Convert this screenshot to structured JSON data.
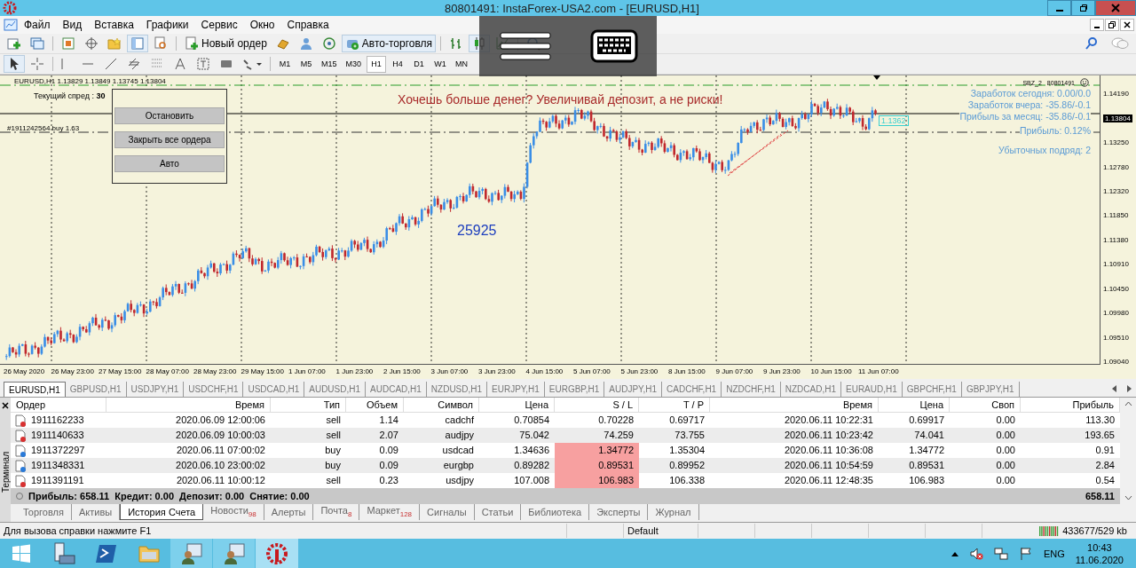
{
  "window": {
    "title": "80801491: InstaForex-USA2.com - [EURUSD,H1]"
  },
  "menu": [
    "Файл",
    "Вид",
    "Вставка",
    "Графики",
    "Сервис",
    "Окно",
    "Справка"
  ],
  "toolbar": {
    "new_order": "Новый ордер",
    "autotrading": "Авто-торговля"
  },
  "timeframes": [
    {
      "label": "M1",
      "selected": false
    },
    {
      "label": "M5",
      "selected": false
    },
    {
      "label": "M15",
      "selected": false
    },
    {
      "label": "M30",
      "selected": false
    },
    {
      "label": "H1",
      "selected": true
    },
    {
      "label": "H4",
      "selected": false
    },
    {
      "label": "D1",
      "selected": false
    },
    {
      "label": "W1",
      "selected": false
    },
    {
      "label": "MN",
      "selected": false
    }
  ],
  "chart": {
    "header": "EURUSD,H1  1.13829 1.13849 1.13745 1.13804",
    "spread_label": "Текущий спред :",
    "spread_value": "30",
    "panel_buttons": [
      "Остановить",
      "Закрыть все ордера",
      "Авто"
    ],
    "order_line_label": "#1911242564 buy 1.63",
    "banner": "Хочешь больше денег? Увеличивай депозит, а не риски!",
    "counter": "25925",
    "expert": "SBZ_2",
    "account": "80801491",
    "stats": [
      "Заработок сегодня: 0.00/0.0",
      "Заработок вчера: -35.86/-0.1",
      "Прибыль за месяц: -35.86/-0.1",
      "Прибыль: 0.12%",
      "Убыточных подряд: 2"
    ],
    "line_price": "1.1362",
    "price_axis": [
      {
        "label": "1.14190",
        "kind": "tick"
      },
      {
        "label": "1.13804",
        "kind": "current"
      },
      {
        "label": "1.13250",
        "kind": "tick"
      },
      {
        "label": "1.12780",
        "kind": "tick"
      },
      {
        "label": "1.12320",
        "kind": "tick"
      },
      {
        "label": "1.11850",
        "kind": "tick"
      },
      {
        "label": "1.11380",
        "kind": "tick"
      },
      {
        "label": "1.10910",
        "kind": "tick"
      },
      {
        "label": "1.10450",
        "kind": "tick"
      },
      {
        "label": "1.09980",
        "kind": "tick"
      },
      {
        "label": "1.09510",
        "kind": "tick"
      },
      {
        "label": "1.09040",
        "kind": "tick"
      }
    ],
    "time_axis": [
      "26 May 2020",
      "26 May 23:00",
      "27 May 15:00",
      "28 May 07:00",
      "28 May 23:00",
      "29 May 15:00",
      "1 Jun 07:00",
      "1 Jun 23:00",
      "2 Jun 15:00",
      "3 Jun 07:00",
      "3 Jun 23:00",
      "4 Jun 15:00",
      "5 Jun 07:00",
      "5 Jun 23:00",
      "8 Jun 15:00",
      "9 Jun 07:00",
      "9 Jun 23:00",
      "10 Jun 15:00",
      "11 Jun 07:00"
    ]
  },
  "symbol_tabs": [
    {
      "label": "EURUSD,H1",
      "selected": true
    },
    {
      "label": "GBPUSD,H1",
      "selected": false
    },
    {
      "label": "USDJPY,H1",
      "selected": false
    },
    {
      "label": "USDCHF,H1",
      "selected": false
    },
    {
      "label": "USDCAD,H1",
      "selected": false
    },
    {
      "label": "AUDUSD,H1",
      "selected": false
    },
    {
      "label": "AUDCAD,H1",
      "selected": false
    },
    {
      "label": "NZDUSD,H1",
      "selected": false
    },
    {
      "label": "EURJPY,H1",
      "selected": false
    },
    {
      "label": "EURGBP,H1",
      "selected": false
    },
    {
      "label": "AUDJPY,H1",
      "selected": false
    },
    {
      "label": "CADCHF,H1",
      "selected": false
    },
    {
      "label": "NZDCHF,H1",
      "selected": false
    },
    {
      "label": "NZDCAD,H1",
      "selected": false
    },
    {
      "label": "EURAUD,H1",
      "selected": false
    },
    {
      "label": "GBPCHF,H1",
      "selected": false
    },
    {
      "label": "GBPJPY,H1",
      "selected": false
    }
  ],
  "terminal": {
    "side_label": "Терминал",
    "columns": [
      "Ордер",
      "Время",
      "Тип",
      "Объем",
      "Символ",
      "Цена",
      "S / L",
      "T / P",
      "Время",
      "Цена",
      "Своп",
      "Прибыль"
    ],
    "rows": [
      {
        "kind": "sell",
        "sl_hit": false,
        "cells": [
          "1911162233",
          "2020.06.09 12:00:06",
          "sell",
          "1.14",
          "cadchf",
          "0.70854",
          "0.70228",
          "0.69717",
          "2020.06.11 10:22:31",
          "0.69917",
          "0.00",
          "113.30"
        ]
      },
      {
        "kind": "sell",
        "sl_hit": false,
        "cells": [
          "1911140633",
          "2020.06.09 10:00:03",
          "sell",
          "2.07",
          "audjpy",
          "75.042",
          "74.259",
          "73.755",
          "2020.06.11 10:23:42",
          "74.041",
          "0.00",
          "193.65"
        ]
      },
      {
        "kind": "buy",
        "sl_hit": true,
        "cells": [
          "1911372297",
          "2020.06.11 07:00:02",
          "buy",
          "0.09",
          "usdcad",
          "1.34636",
          "1.34772",
          "1.35304",
          "2020.06.11 10:36:08",
          "1.34772",
          "0.00",
          "0.91"
        ]
      },
      {
        "kind": "buy",
        "sl_hit": true,
        "cells": [
          "1911348331",
          "2020.06.10 23:00:02",
          "buy",
          "0.09",
          "eurgbp",
          "0.89282",
          "0.89531",
          "0.89952",
          "2020.06.11 10:54:59",
          "0.89531",
          "0.00",
          "2.84"
        ]
      },
      {
        "kind": "sell",
        "sl_hit": true,
        "cells": [
          "1911391191",
          "2020.06.11 10:00:12",
          "sell",
          "0.23",
          "usdjpy",
          "107.008",
          "106.983",
          "106.338",
          "2020.06.11 12:48:35",
          "106.983",
          "0.00",
          "0.54"
        ]
      }
    ],
    "summary": "Прибыль: 658.11  Кредит: 0.00  Депозит: 0.00  Снятие: 0.00",
    "total": "658.11",
    "tabs": [
      {
        "label": "Торговля",
        "selected": false
      },
      {
        "label": "Активы",
        "selected": false
      },
      {
        "label": "История Счета",
        "selected": true
      },
      {
        "label": "Новости",
        "badge": "98",
        "selected": false
      },
      {
        "label": "Алерты",
        "selected": false
      },
      {
        "label": "Почта",
        "badge": "8",
        "selected": false
      },
      {
        "label": "Маркет",
        "badge": "128",
        "selected": false
      },
      {
        "label": "Сигналы",
        "selected": false
      },
      {
        "label": "Статьи",
        "selected": false
      },
      {
        "label": "Библиотека",
        "selected": false
      },
      {
        "label": "Эксперты",
        "selected": false
      },
      {
        "label": "Журнал",
        "selected": false
      }
    ]
  },
  "status_bar": {
    "help": "Для вызова справки нажмите F1",
    "profile": "Default",
    "traffic": "433677/529 kb"
  },
  "taskbar": {
    "language": "ENG",
    "time": "10:43",
    "date": "11.06.2020"
  }
}
